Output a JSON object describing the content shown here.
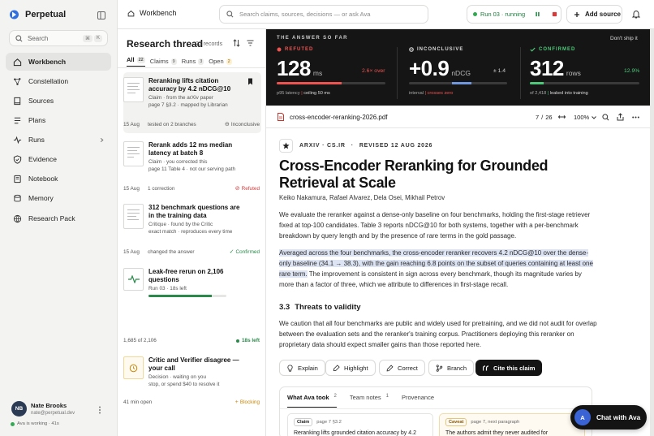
{
  "app": {
    "name": "Perpetual",
    "search_label": "Search",
    "kbd": [
      "⌘",
      "K"
    ]
  },
  "nav": [
    "Workbench",
    "Constellation",
    "Sources",
    "Plans",
    "Runs",
    "Evidence",
    "Notebook",
    "Memory",
    "Research Pack"
  ],
  "user": {
    "initials": "NB",
    "name": "Nate Brooks",
    "email": "nate@perpetual.dev",
    "status": "Ava is working · 41s"
  },
  "topbar": {
    "breadcrumb": "Workbench",
    "search_placeholder": "Search claims, sources, decisions — or ask Ava",
    "run_label": "Run 03 · running",
    "add_source": "Add source"
  },
  "thread": {
    "title": "Research thread",
    "count": "22 records",
    "filters": [
      {
        "label": "All",
        "count": "22"
      },
      {
        "label": "Claims",
        "count": "9"
      },
      {
        "label": "Runs",
        "count": "3"
      },
      {
        "label": "Open",
        "count": "2"
      }
    ],
    "cards": [
      {
        "title": "Reranking lifts citation accuracy by 4.2 nDCG@10",
        "sub1": "Claim · from the arXiv paper",
        "sub2": "page 7 §3.2 · mapped by Librarian",
        "date": "15 Aug",
        "meta": "tested on 2 branches",
        "status": "Inconclusive"
      },
      {
        "title": "Rerank adds 12 ms median latency at batch 8",
        "sub1": "Claim · you corrected this",
        "sub2": "page 11 Table 4 · not our serving path",
        "date": "15 Aug",
        "meta": "1 correction",
        "status": "Refuted"
      },
      {
        "title": "312 benchmark questions are in the training data",
        "sub1": "Critique · found by the Critic",
        "sub2": "exact match · reproduces every time",
        "date": "15 Aug",
        "meta": "changed the answer",
        "status": "Confirmed"
      },
      {
        "title": "Leak-free rerun on 2,106 questions",
        "sub1": "Run 03 · 18s left",
        "progress": 0.81,
        "foot_left": "1,685 of 2,106",
        "foot_right": "18s left"
      },
      {
        "title": "Critic and Verifier disagree — your call",
        "sub1": "Decision · waiting on you",
        "sub2": "stop, or spend $40 to resolve it",
        "date": "41 min open",
        "status": "Blocking"
      }
    ]
  },
  "metrics": {
    "header": "THE ANSWER SO FAR",
    "dont_ship": "Don't ship it",
    "cols": [
      {
        "label": "REFUTED",
        "value": "128",
        "unit": "ms",
        "delta": "2.6× over",
        "foot_a": "p95 latency",
        "foot_b": "ceiling 50 ms",
        "fill": 0.6
      },
      {
        "label": "INCONCLUSIVE",
        "value": "+0.9",
        "unit": "nDCG",
        "delta": "± 1.4",
        "foot_a": "interval",
        "foot_b": "crosses zero",
        "fill": 0.2
      },
      {
        "label": "CONFIRMED",
        "value": "312",
        "unit": "rows",
        "delta": "12.9%",
        "foot_a": "of 2,418",
        "foot_b": "leaked into training",
        "fill": 0.129
      }
    ],
    "colors": {
      "refuted": "#ef5350",
      "confirmed": "#4cca7a",
      "inconclusive": "#6e97e0"
    }
  },
  "pdf": {
    "filename": "cross-encoder-reranking-2026.pdf",
    "page": "7",
    "pages": "26",
    "zoom": "100%"
  },
  "paper": {
    "source": "ARXIV · CS.IR",
    "revised": "REVISED 12 AUG 2026",
    "title": "Cross-Encoder Reranking for Grounded Retrieval at Scale",
    "authors": "Keiko Nakamura, Rafael Alvarez, Dela Osei, Mikhail Petrov",
    "p1": "We evaluate the reranker against a dense-only baseline on four benchmarks, holding the first-stage retriever fixed at top-100 candidates. Table 3 reports nDCG@10 for both systems, together with a per-benchmark breakdown by query length and by the presence of rare terms in the gold passage.",
    "p2_hl": "Averaged across the four benchmarks, the cross-encoder reranker recovers 4.2 nDCG@10 over the dense-only baseline (34.1 → 38.3), with the gain reaching 6.8 points on the subset of queries containing at least one rare term.",
    "p2_rest": " The improvement is consistent in sign across every benchmark, though its magnitude varies by more than a factor of three, which we attribute to differences in first-stage recall.",
    "section_num": "3.3",
    "section": "Threats to validity",
    "p3": "We caution that all four benchmarks are public and widely used for pretraining, and we did not audit for overlap between the evaluation sets and the reranker's training corpus. Practitioners deploying this reranker on proprietary data should expect smaller gains than those reported here."
  },
  "actions": [
    "Explain",
    "Highlight",
    "Correct",
    "Branch",
    "Cite this claim"
  ],
  "tabs": [
    {
      "label": "What Ava took",
      "count": "2"
    },
    {
      "label": "Team notes",
      "count": "1"
    },
    {
      "label": "Provenance",
      "count": ""
    }
  ],
  "notes": [
    {
      "badge": "Claim",
      "where": "page 7 §3.2",
      "text": "Reranking lifts grounded citation accuracy by 4.2"
    },
    {
      "badge": "Caveat",
      "where": "page 7, next paragraph",
      "text": "The authors admit they never audited for"
    }
  ],
  "chat": {
    "avatar": "A",
    "label": "Chat with Ava"
  }
}
